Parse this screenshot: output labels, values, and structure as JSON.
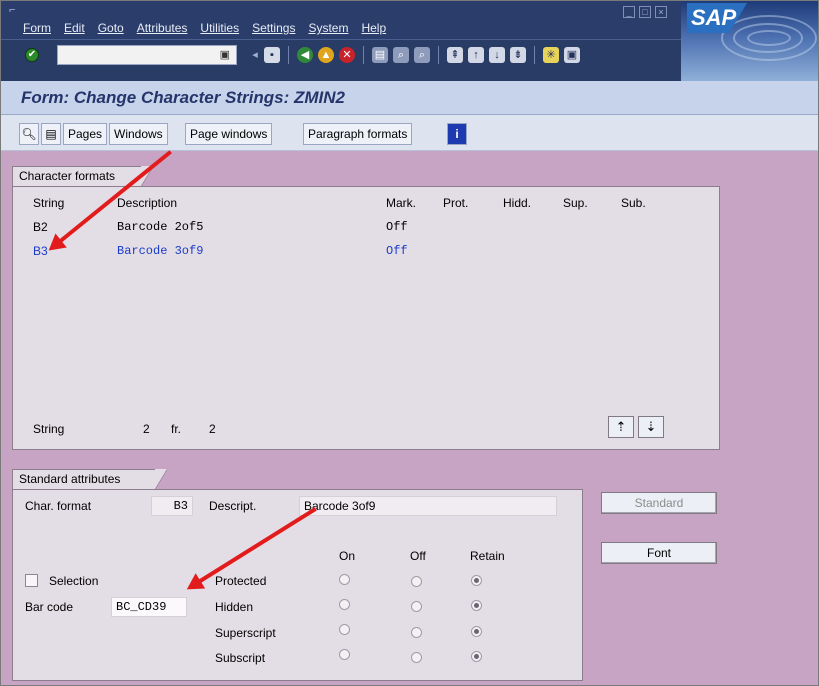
{
  "menu": {
    "items": [
      "Form",
      "Edit",
      "Goto",
      "Attributes",
      "Utilities",
      "Settings",
      "System",
      "Help"
    ]
  },
  "brand": {
    "logo": "SAP"
  },
  "title": "Form: Change Character Strings: ZMIN2",
  "app_toolbar": {
    "pages": "Pages",
    "windows": "Windows",
    "page_windows": "Page windows",
    "paragraph_formats": "Paragraph formats"
  },
  "char_formats": {
    "tab": "Character formats",
    "headers": {
      "string": "String",
      "description": "Description",
      "mark": "Mark.",
      "prot": "Prot.",
      "hidd": "Hidd.",
      "sup": "Sup.",
      "sub": "Sub."
    },
    "rows": [
      {
        "string": "B2",
        "description": "Barcode 2of5",
        "mark": "Off"
      },
      {
        "string": "B3",
        "description": "Barcode 3of9",
        "mark": "Off"
      }
    ],
    "footer": {
      "label": "String",
      "current": "2",
      "fr": "fr.",
      "total": "2"
    }
  },
  "std_attrs": {
    "tab": "Standard attributes",
    "char_format_label": "Char. format",
    "char_format_value": "B3",
    "descript_label": "Descript.",
    "descript_value": "Barcode 3of9",
    "standard_button": "Standard",
    "font_button": "Font",
    "col_on": "On",
    "col_off": "Off",
    "col_retain": "Retain",
    "selection_label": "Selection",
    "barcode_label": "Bar code",
    "barcode_value": "BC_CD39",
    "attributes": [
      "Protected",
      "Hidden",
      "Superscript",
      "Subscript"
    ]
  },
  "colors": {
    "accent": "#e21c1c",
    "selected_row": "#1a3cc8",
    "background": "#c7a3c4"
  }
}
